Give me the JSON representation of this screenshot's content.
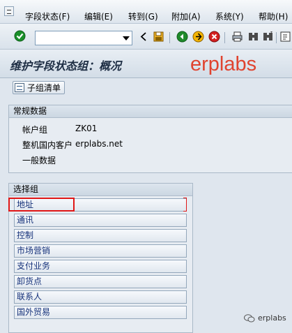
{
  "menu": {
    "items": [
      {
        "label": "字段状态(F)"
      },
      {
        "label": "编辑(E)"
      },
      {
        "label": "转到(G)"
      },
      {
        "label": "附加(A)"
      },
      {
        "label": "系统(Y)"
      },
      {
        "label": "帮助(H)"
      }
    ]
  },
  "toolbar": {
    "command_value": "",
    "icons": [
      "enter-checkmark-icon",
      "command-dropdown-icon",
      "back-arrow-icon",
      "save-icon",
      "back-icon",
      "exit-icon",
      "cancel-icon",
      "print-icon",
      "find-icon",
      "find-next-icon",
      "first-page-icon"
    ]
  },
  "title": {
    "text": "维护字段状态组：概况",
    "watermark": "erplabs"
  },
  "app_toolbar": {
    "subgroup_list_label": "子组清单"
  },
  "general_data": {
    "heading": "常规数据",
    "fields": [
      {
        "label": "帐户组",
        "value": "ZK01"
      },
      {
        "label": "整机国内客户",
        "value": "erplabs.net"
      },
      {
        "label": "一般数据",
        "value": ""
      }
    ]
  },
  "select_group": {
    "heading": "选择组",
    "items": [
      "地址",
      "通讯",
      "控制",
      "市场营销",
      "支付业务",
      "卸货点",
      "联系人",
      "国外贸易"
    ]
  },
  "footer": {
    "brand": "erplabs"
  },
  "colors": {
    "highlight": "#e01616",
    "watermark": "#e0432f"
  }
}
